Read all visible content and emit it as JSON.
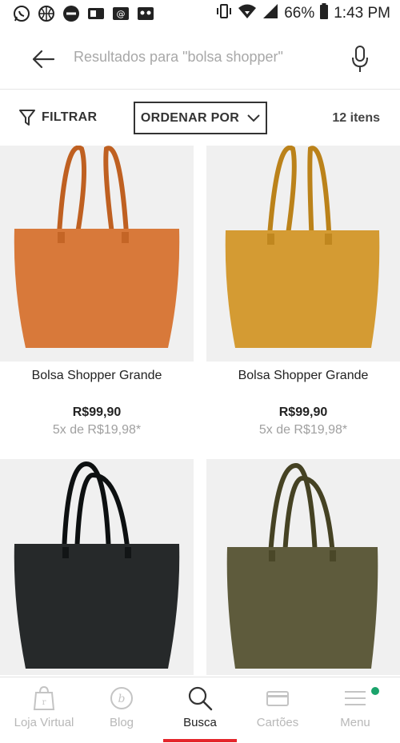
{
  "status_bar": {
    "battery": "66%",
    "time": "1:43 PM"
  },
  "search": {
    "placeholder": "Resultados para \"bolsa shopper\""
  },
  "toolbar": {
    "filter_label": "FILTRAR",
    "sort_label": "ORDENAR POR",
    "item_count": "12 itens"
  },
  "products": [
    {
      "name": "Bolsa Shopper Grande",
      "price": "R$99,90",
      "installments": "5x de R$19,98*",
      "color": "#d8793a"
    },
    {
      "name": "Bolsa Shopper Grande",
      "price": "R$99,90",
      "installments": "5x de R$19,98*",
      "color": "#d49b33"
    },
    {
      "color": "#26292a"
    },
    {
      "color": "#5e5b3c"
    }
  ],
  "bottom_nav": {
    "items": [
      {
        "label": "Loja Virtual",
        "icon": "store-icon"
      },
      {
        "label": "Blog",
        "icon": "blog-icon"
      },
      {
        "label": "Busca",
        "icon": "search-icon"
      },
      {
        "label": "Cartões",
        "icon": "card-icon"
      },
      {
        "label": "Menu",
        "icon": "menu-icon"
      }
    ],
    "active": "Busca"
  },
  "colors": {
    "accent": "#e4262c",
    "notification": "#1aa36b"
  }
}
